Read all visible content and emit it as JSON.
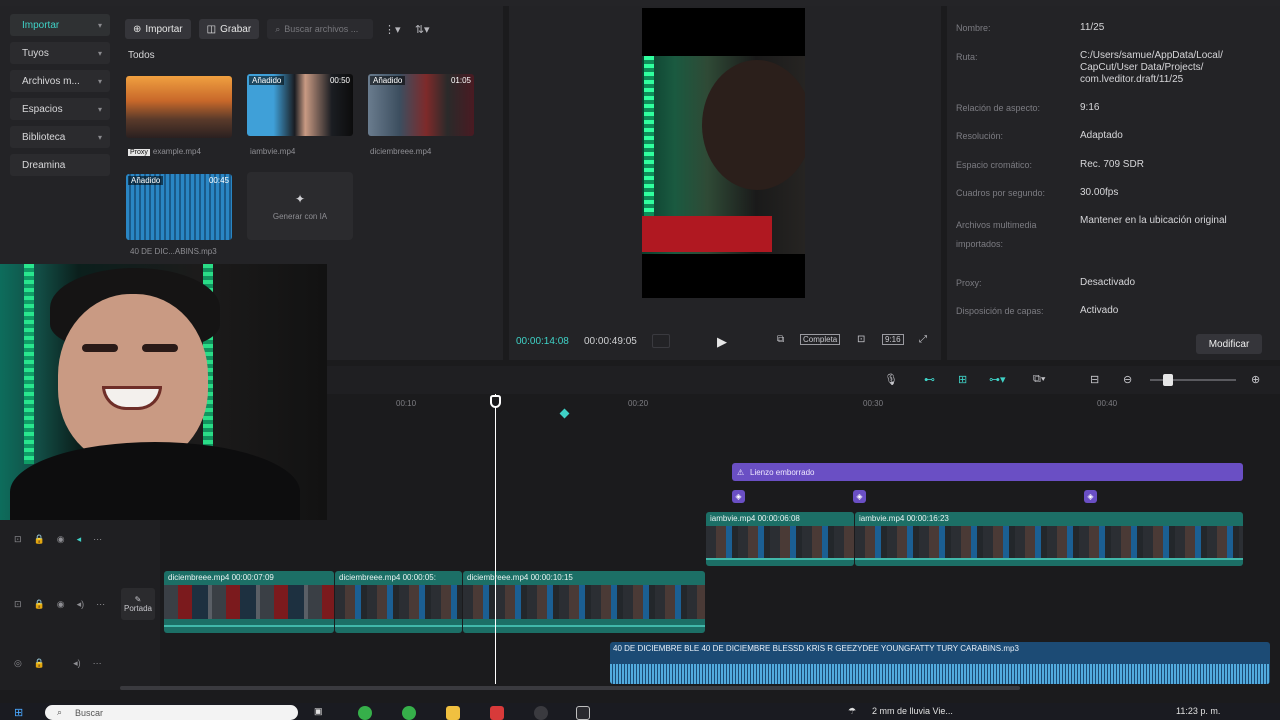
{
  "sidebar": {
    "items": [
      {
        "label": "Importar",
        "active": true
      },
      {
        "label": "Tuyos"
      },
      {
        "label": "Archivos m..."
      },
      {
        "label": "Espacios"
      },
      {
        "label": "Biblioteca"
      },
      {
        "label": "Dreamina"
      }
    ]
  },
  "media": {
    "import_label": "Importar",
    "record_label": "Grabar",
    "search_placeholder": "Buscar archivos ...",
    "section": "Todos",
    "items": [
      {
        "name": "example.mp4",
        "proxy": "Proxy"
      },
      {
        "name": "iambvie.mp4",
        "tag": "Añadido",
        "duration": "00:50"
      },
      {
        "name": "diciembreee.mp4",
        "tag": "Añadido",
        "duration": "01:05"
      },
      {
        "name": "40 DE DIC...ABINS.mp3",
        "tag": "Añadido",
        "duration": "00:45"
      }
    ],
    "generate_label": "Generar con IA"
  },
  "player": {
    "current_time": "00:00:14:08",
    "total_time": "00:00:49:05",
    "full_label": "Completa",
    "ratio_label": "9:16"
  },
  "properties": {
    "rows": [
      {
        "label": "Nombre:",
        "value": "11/25"
      },
      {
        "label": "Ruta:",
        "value": "C:/Users/samue/AppData/Local/ CapCut/User Data/Projects/ com.lveditor.draft/11/25"
      },
      {
        "label": "Relación de aspecto:",
        "value": "9:16"
      },
      {
        "label": "Resolución:",
        "value": "Adaptado"
      },
      {
        "label": "Espacio cromático:",
        "value": "Rec. 709 SDR"
      },
      {
        "label": "Cuadros por segundo:",
        "value": "30.00fps"
      },
      {
        "label": "Archivos multimedia importados:",
        "value": "Mantener en la ubicación original"
      },
      {
        "label": "Proxy:",
        "value": "Desactivado"
      },
      {
        "label": "Disposición de capas:",
        "value": "Activado"
      }
    ],
    "modify_label": "Modificar"
  },
  "timeline": {
    "ruler": [
      "00:10",
      "00:20",
      "00:30",
      "00:40"
    ],
    "overlay_label": "Lienzo emborrado",
    "clips_top": [
      {
        "title": "iambvie.mp4  00:00:06:08"
      },
      {
        "title": "iambvie.mp4  00:00:16:23"
      }
    ],
    "clips_main": [
      {
        "title": "diciembreee.mp4  00:00:07:09"
      },
      {
        "title": "diciembreee.mp4  00:00:05:"
      },
      {
        "title": "diciembreee.mp4  00:00:10:15"
      }
    ],
    "audio_title": "40 DE DICIEMBRE  BLE  40 DE DICIEMBRE  BLESSD  KRIS R  GEEZYDEE  YOUNGFATTY  TURY  CARABINS.mp3",
    "cover_label": "Portada"
  },
  "taskbar": {
    "search_placeholder": "Buscar",
    "weather": "2 mm de lluvia Vie...",
    "time": "11:23 p. m."
  },
  "colors": {
    "accent": "#3fd2c7",
    "overlay": "#6a4fc4",
    "clip": "#1c6f66",
    "audio": "#1c4b75"
  }
}
